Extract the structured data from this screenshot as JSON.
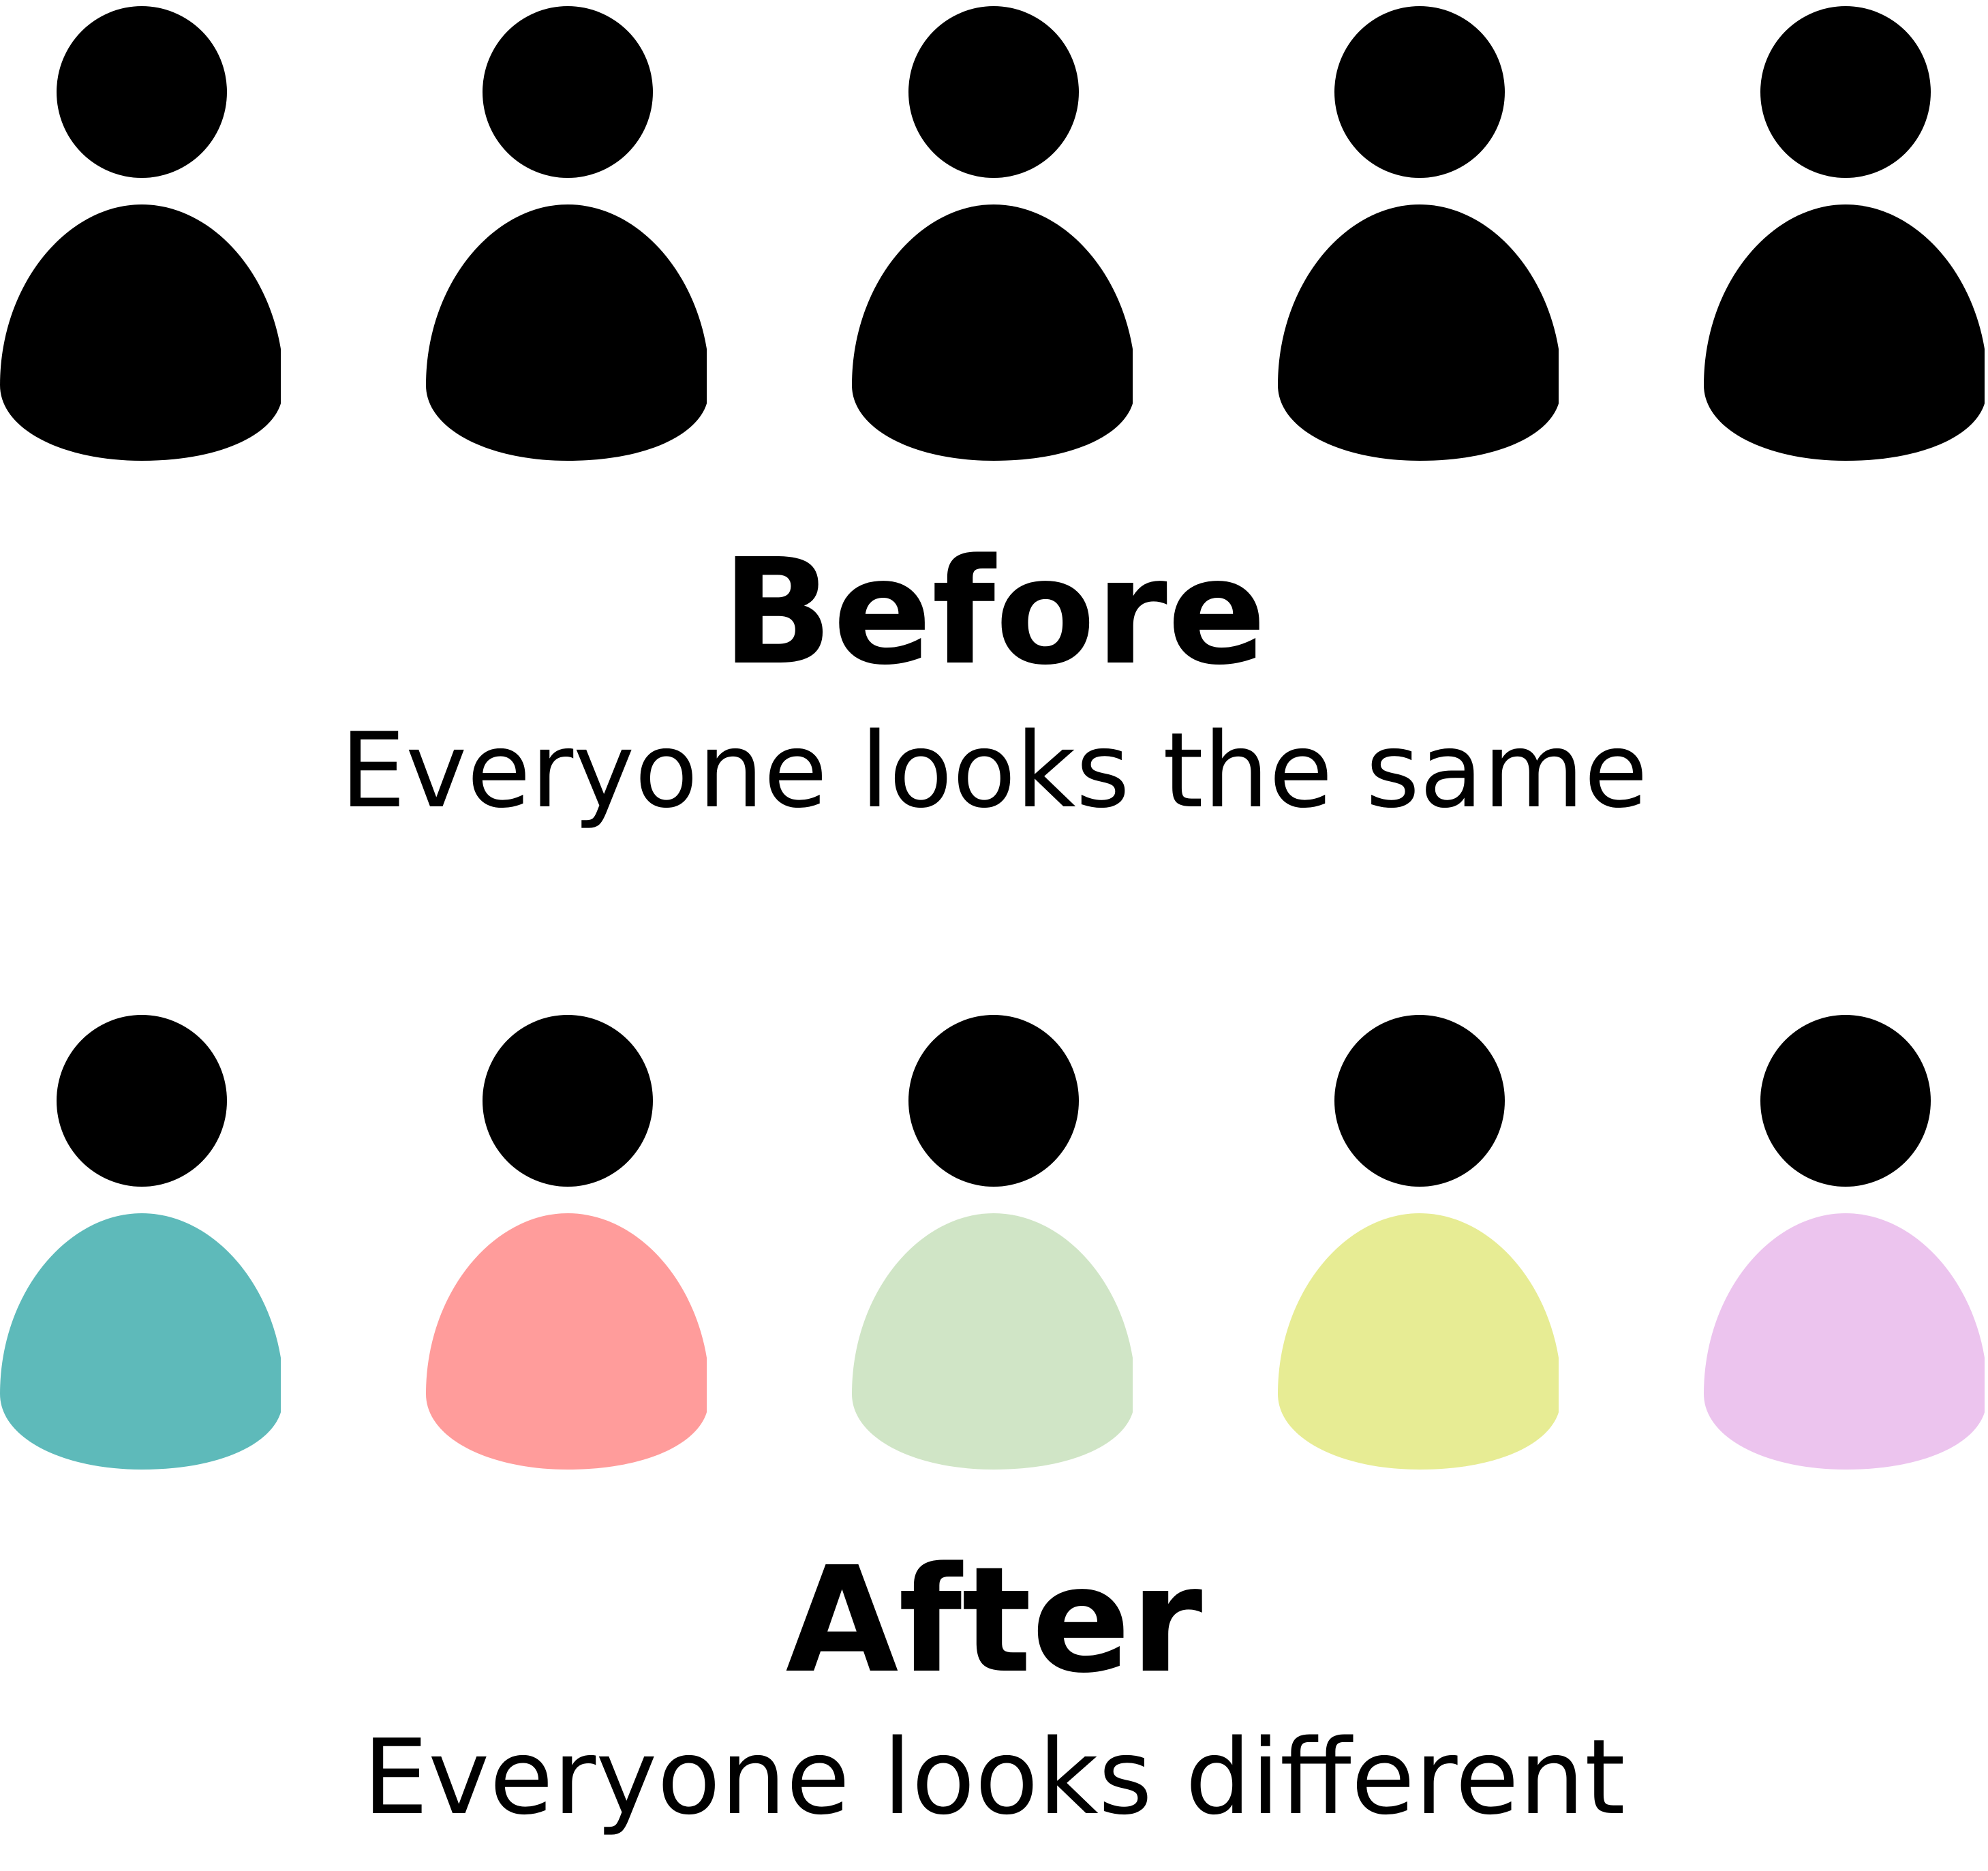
{
  "before": {
    "heading": "Before",
    "caption": "Everyone looks the same",
    "people": [
      {
        "head_color": "#000000",
        "body_color": "#000000"
      },
      {
        "head_color": "#000000",
        "body_color": "#000000"
      },
      {
        "head_color": "#000000",
        "body_color": "#000000"
      },
      {
        "head_color": "#000000",
        "body_color": "#000000"
      },
      {
        "head_color": "#000000",
        "body_color": "#000000"
      }
    ]
  },
  "after": {
    "heading": "After",
    "caption": "Everyone looks different",
    "people": [
      {
        "head_color": "#000000",
        "body_color": "#5EBABA"
      },
      {
        "head_color": "#000000",
        "body_color": "#FF9C9B"
      },
      {
        "head_color": "#000000",
        "body_color": "#D0E5C6"
      },
      {
        "head_color": "#000000",
        "body_color": "#E7EC94"
      },
      {
        "head_color": "#000000",
        "body_color": "#ECC4EE"
      }
    ]
  }
}
